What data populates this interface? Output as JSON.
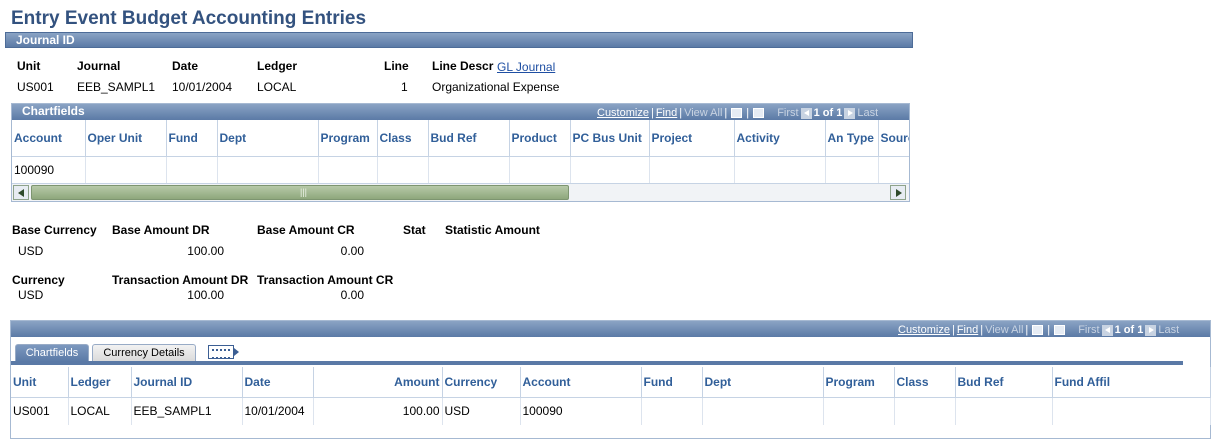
{
  "page": {
    "title": "Entry Event Budget Accounting Entries"
  },
  "journal": {
    "section_title": "Journal ID",
    "labels": {
      "unit": "Unit",
      "journal": "Journal",
      "date": "Date",
      "ledger": "Ledger",
      "line": "Line",
      "line_descr": "Line Descr"
    },
    "values": {
      "unit": "US001",
      "journal": "EEB_SAMPL1",
      "date": "10/01/2004",
      "ledger": "LOCAL",
      "line": "1",
      "line_descr": "Organizational Expense",
      "gl_link": "GL Journal"
    }
  },
  "chartfields_grid": {
    "title": "Chartfields",
    "nav": {
      "customize": "Customize",
      "find": "Find",
      "view_all": "View All",
      "first": "First",
      "count": "1 of 1",
      "last": "Last"
    },
    "columns": [
      "Account",
      "Oper Unit",
      "Fund",
      "Dept",
      "Program",
      "Class",
      "Bud Ref",
      "Product",
      "PC Bus Unit",
      "Project",
      "Activity",
      "An Type",
      "Source"
    ],
    "rows": [
      [
        "100090",
        "",
        "",
        "",
        "",
        "",
        "",
        "",
        "",
        "",
        "",
        "",
        ""
      ]
    ],
    "scroll_grip": "|||"
  },
  "amounts": {
    "labels": {
      "base_currency": "Base Currency",
      "base_dr": "Base Amount DR",
      "base_cr": "Base Amount CR",
      "stat": "Stat",
      "stat_amount": "Statistic Amount",
      "currency": "Currency",
      "tran_dr": "Transaction Amount DR",
      "tran_cr": "Transaction Amount CR"
    },
    "values": {
      "base_currency": "USD",
      "base_dr": "100.00",
      "base_cr": "0.00",
      "currency": "USD",
      "tran_dr": "100.00",
      "tran_cr": "0.00"
    }
  },
  "entries_grid": {
    "nav": {
      "customize": "Customize",
      "find": "Find",
      "view_all": "View All",
      "first": "First",
      "count": "1 of 1",
      "last": "Last"
    },
    "tabs": [
      "Chartfields",
      "Currency Details"
    ],
    "columns": [
      "Unit",
      "Ledger",
      "Journal ID",
      "Date",
      "Amount",
      "Currency",
      "Account",
      "Fund",
      "Dept",
      "Program",
      "Class",
      "Bud Ref",
      "Fund Affil"
    ],
    "rows": [
      [
        "US001",
        "LOCAL",
        "EEB_SAMPL1",
        "10/01/2004",
        "100.00",
        "USD",
        "100090",
        "",
        "",
        "",
        "",
        "",
        ""
      ]
    ]
  }
}
